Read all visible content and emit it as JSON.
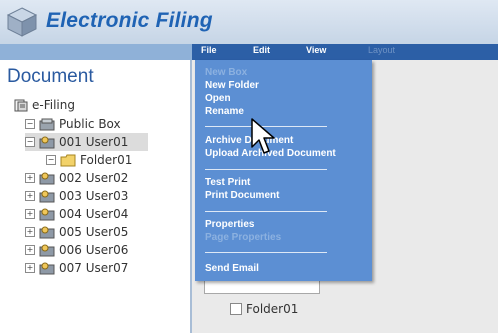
{
  "app": {
    "title": "Electronic Filing"
  },
  "menubar": [
    {
      "label": "File",
      "enabled": true
    },
    {
      "label": "Edit",
      "enabled": true
    },
    {
      "label": "View",
      "enabled": true
    },
    {
      "label": "Layout",
      "enabled": false
    }
  ],
  "left_pane": {
    "heading": "Document",
    "tree": [
      {
        "label": "e-Filing",
        "icon": "e-filing-icon",
        "expander": ""
      },
      {
        "label": "Public Box",
        "icon": "public-box-icon",
        "expander": "−"
      },
      {
        "label": "001 User01",
        "icon": "user-box-icon",
        "expander": "−",
        "selected": true
      },
      {
        "label": "Folder01",
        "icon": "folder-icon",
        "expander": "−"
      },
      {
        "label": "002 User02",
        "icon": "user-box-icon",
        "expander": "+"
      },
      {
        "label": "003 User03",
        "icon": "user-box-icon",
        "expander": "+"
      },
      {
        "label": "004 User04",
        "icon": "user-box-icon",
        "expander": "+"
      },
      {
        "label": "005 User05",
        "icon": "user-box-icon",
        "expander": "+"
      },
      {
        "label": "006 User06",
        "icon": "user-box-icon",
        "expander": "+"
      },
      {
        "label": "007 User07",
        "icon": "user-box-icon",
        "expander": "+"
      }
    ]
  },
  "file_menu": {
    "items": [
      {
        "label": "New Box",
        "enabled": false
      },
      {
        "label": "New Folder",
        "enabled": true
      },
      {
        "label": "Open",
        "enabled": true
      },
      {
        "label": "Rename",
        "enabled": true
      },
      {
        "label": "Archive Document",
        "enabled": true
      },
      {
        "label": "Upload Archived Document",
        "enabled": true
      },
      {
        "label": "Test Print",
        "enabled": true
      },
      {
        "label": "Print Document",
        "enabled": true
      },
      {
        "label": "Properties",
        "enabled": true
      },
      {
        "label": "Page Properties",
        "enabled": false
      },
      {
        "label": "Send Email",
        "enabled": true
      }
    ]
  },
  "content": {
    "folder_label": "Folder01"
  },
  "colors": {
    "menu_bg": "#5c8fd3",
    "menubar_bg": "#2c5fa6",
    "title": "#1f63b4"
  }
}
